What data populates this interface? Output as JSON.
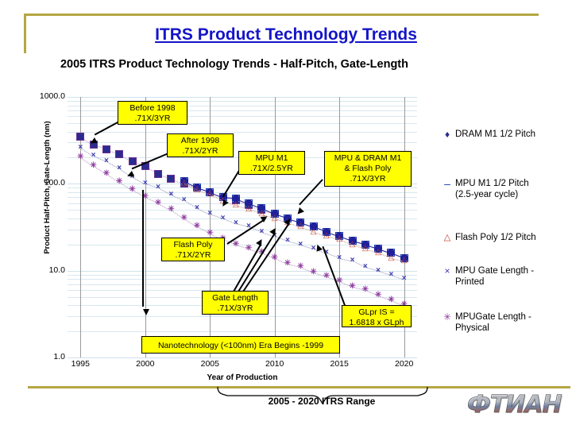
{
  "slide": {
    "title": "ITRS Product Technology Trends",
    "accent_color": "#b5a642",
    "title_color": "#1414c8",
    "footer_range_label": "2005 - 2020 ITRS Range",
    "logo_text": "ФТИАН"
  },
  "chart_data": {
    "type": "scatter",
    "title": "2005 ITRS Product Technology Trends -\nHalf-Pitch, Gate-Length",
    "xlabel": "Year of Production",
    "ylabel": "Product Half-Pitch, Gate-Length\n(nm)",
    "xlim": [
      1994,
      2021
    ],
    "ylim": [
      1.0,
      1000.0
    ],
    "yscale": "log",
    "grid": true,
    "legend_position": "right",
    "xticks": [
      "1995",
      "2000",
      "2005",
      "2010",
      "2015",
      "2020"
    ],
    "yticks": [
      "1000.0",
      "100.0",
      "10.0",
      "1.0"
    ],
    "series": [
      {
        "name": "DRAM M1 1/2 Pitch",
        "symbol": "filled-diamond",
        "color": "#2b2b8f",
        "x": [
          1995,
          1996,
          1997,
          1998,
          1999,
          2000,
          2001,
          2002,
          2003,
          2004,
          2005,
          2006,
          2007,
          2008,
          2009,
          2010,
          2011,
          2012,
          2013,
          2014,
          2015,
          2016,
          2017,
          2018,
          2019,
          2020
        ],
        "y": [
          350,
          280,
          250,
          220,
          180,
          160,
          130,
          115,
          100,
          90,
          80,
          70,
          65,
          57,
          50,
          45,
          40,
          36,
          32,
          28,
          25,
          22,
          20,
          18,
          16,
          14
        ]
      },
      {
        "name": "MPU M1 1/2 Pitch (2.5-year cycle)",
        "symbol": "open-square",
        "color": "#1f3fa8",
        "x": [
          2003,
          2004,
          2005,
          2006,
          2007,
          2008,
          2009,
          2010,
          2011,
          2012,
          2013,
          2014,
          2015,
          2016,
          2017,
          2018,
          2019,
          2020
        ],
        "y": [
          107,
          90,
          80,
          70,
          68,
          59,
          52,
          45,
          40,
          36,
          32,
          28,
          25,
          22,
          20,
          18,
          16,
          14
        ]
      },
      {
        "name": "Flash Poly 1/2 Pitch",
        "symbol": "open-triangle",
        "color": "#c0392b",
        "x": [
          2003,
          2004,
          2005,
          2006,
          2007,
          2008,
          2009,
          2010,
          2011,
          2012,
          2013,
          2014,
          2015,
          2016,
          2017,
          2018,
          2019,
          2020
        ],
        "y": [
          100,
          85,
          76,
          64,
          57,
          51,
          45,
          40,
          36,
          32,
          28,
          25,
          23,
          20,
          18,
          16,
          14,
          13
        ]
      },
      {
        "name": "MPU Gate Length - Printed",
        "symbol": "cross-x",
        "color": "#3a3ab0",
        "x": [
          1995,
          1996,
          1997,
          1998,
          1999,
          2000,
          2001,
          2002,
          2003,
          2004,
          2005,
          2006,
          2007,
          2008,
          2009,
          2010,
          2011,
          2012,
          2013,
          2014,
          2015,
          2016,
          2017,
          2018,
          2019,
          2020
        ],
        "y": [
          260,
          210,
          180,
          150,
          120,
          100,
          90,
          75,
          65,
          53,
          45,
          40,
          35,
          32,
          28,
          25,
          22,
          20,
          18,
          16,
          14,
          13,
          11,
          10,
          9,
          8
        ]
      },
      {
        "name": "MPUGate Length - Physical",
        "symbol": "star-asterisk",
        "color": "#8e3a9e",
        "x": [
          1995,
          1996,
          1997,
          1998,
          1999,
          2000,
          2001,
          2002,
          2003,
          2004,
          2005,
          2006,
          2007,
          2008,
          2009,
          2010,
          2011,
          2012,
          2013,
          2014,
          2015,
          2016,
          2017,
          2018,
          2019,
          2020
        ],
        "y": [
          200,
          160,
          130,
          105,
          85,
          70,
          60,
          50,
          40,
          32,
          27,
          23,
          20,
          18,
          16,
          14,
          12,
          11,
          9.5,
          8.5,
          7.5,
          6.5,
          6,
          5.2,
          4.6,
          4
        ]
      }
    ],
    "annotations": [
      {
        "id": "before-1998",
        "text": "Before 1998\n.71X/3YR"
      },
      {
        "id": "after-1998",
        "text": "After 1998\n.71X/2YR"
      },
      {
        "id": "mpu-m1",
        "text": "MPU M1\n.71X/2.5YR"
      },
      {
        "id": "mpu-dram-flash",
        "text": "MPU & DRAM M1\n& Flash Poly\n.71X/3YR"
      },
      {
        "id": "flash-poly",
        "text": "Flash Poly\n.71X/2YR"
      },
      {
        "id": "gate-length",
        "text": "Gate Length\n.71X/3YR"
      },
      {
        "id": "glpr",
        "text": "GLpr IS =\n1.6818 x GLph"
      },
      {
        "id": "nanotechnology",
        "text": "Nanotechnology (<100nm) Era Begins -1999"
      }
    ]
  }
}
